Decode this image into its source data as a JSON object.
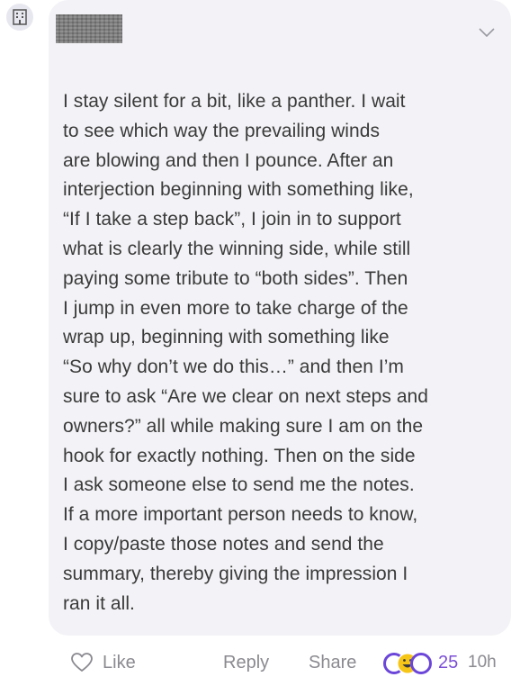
{
  "comment": {
    "author_icon": "building-icon",
    "author_name_redacted": true,
    "menu_icon": "chevron-down-icon",
    "body": "I stay silent for a bit, like a panther. I wait\nto see which way the prevailing winds\nare blowing and then I pounce. After an\ninterjection beginning with something like,\n“If I take a step back”, I join in to support\nwhat is clearly the winning side, while still\npaying some tribute to “both sides”. Then\nI jump in even more to take charge of the\nwrap up, beginning with something like\n“So why don’t we do this…” and then I’m\nsure to ask “Are we clear on next steps and\nowners?” all while making sure I am on the\nhook for exactly nothing. Then on the side\nI ask someone else to send me the notes.\nIf a more important person needs to know,\nI copy/paste those notes and send the\nsummary, thereby giving the impression I\nran it all."
  },
  "actions": {
    "like_label": "Like",
    "reply_label": "Reply",
    "share_label": "Share",
    "reaction_icons": [
      "like-reaction-icon",
      "haha-reaction-icon",
      "insightful-reaction-icon"
    ],
    "reaction_count": "25",
    "timestamp": "10h"
  },
  "colors": {
    "bubble_background": "#f3f3f7",
    "text": "#3a3a3a",
    "muted": "#8a8a90",
    "accent_purple": "#7b4fd6",
    "reaction_yellow": "#f5c518"
  }
}
